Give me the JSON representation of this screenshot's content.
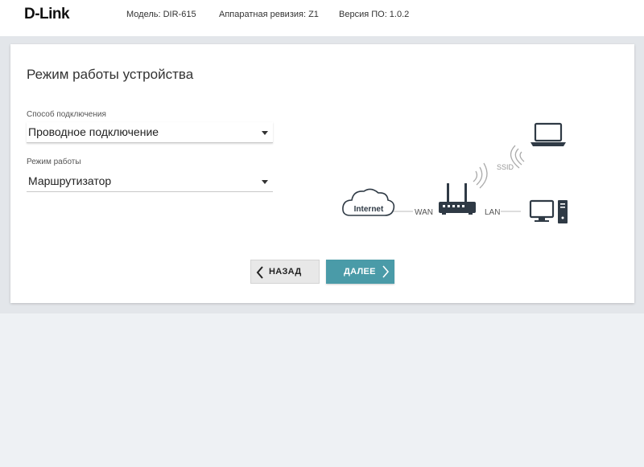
{
  "header": {
    "logo": "D-Link",
    "model": "Модель: DIR-615",
    "hw_revision": "Аппаратная ревизия: Z1",
    "fw_version": "Версия ПО: 1.0.2"
  },
  "main": {
    "title": "Режим работы устройства",
    "connection": {
      "label": "Способ подключения",
      "value": "Проводное подключение"
    },
    "mode": {
      "label": "Режим работы",
      "value": "Маршрутизатор"
    },
    "diagram": {
      "internet": "Internet",
      "wan": "WAN",
      "lan": "LAN",
      "ssid": "SSID"
    },
    "buttons": {
      "back": "НАЗАД",
      "next": "ДАЛЕЕ"
    }
  },
  "colors": {
    "accent": "#4a9ba8",
    "page_bg": "#eef1f4",
    "icon": "#2f3a45"
  }
}
